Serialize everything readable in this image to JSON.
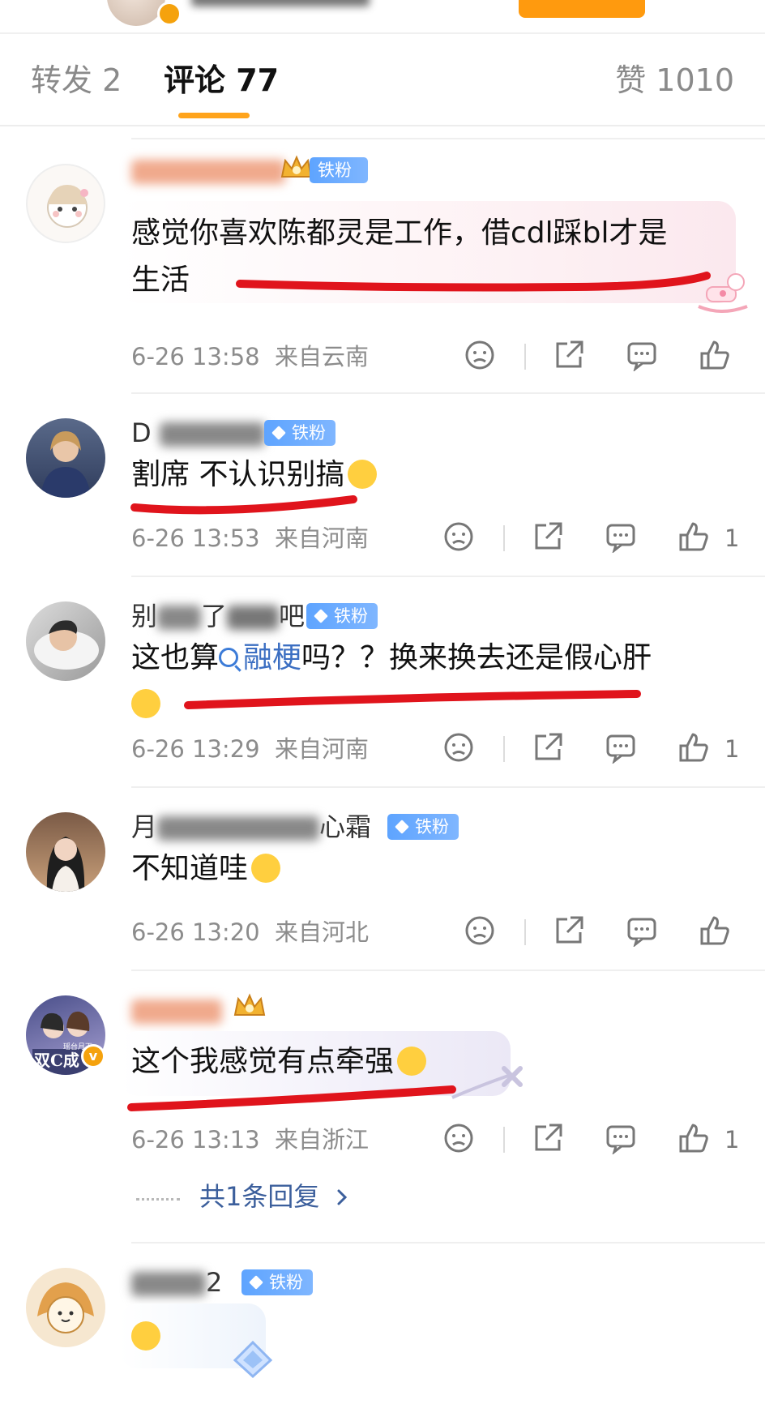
{
  "tabs": {
    "repost": "转发 2",
    "comment": "评论 77",
    "like": "赞 1010"
  },
  "comments": [
    {
      "badge": "铁粉4",
      "text_line1": "感觉你喜欢陈都灵是工作，借cdl踩bl才是",
      "text_line2": "生活",
      "time": "6-26 13:58",
      "location": "来自云南",
      "likes": ""
    },
    {
      "name_visible": "D",
      "badge": "铁粉4",
      "text": "割席 不认识别搞",
      "time": "6-26 13:53",
      "location": "来自河南",
      "likes": "1"
    },
    {
      "name_visible": "别",
      "name_mid": "了",
      "name_end": "吧",
      "badge": "铁粉2",
      "text_pre": "这也算",
      "topic": "融梗",
      "text_post": "吗？？换来换去还是假心肝",
      "time": "6-26 13:29",
      "location": "来自河南",
      "likes": "1"
    },
    {
      "name_visible": "月",
      "name_end": "心霜",
      "badge": "铁粉2",
      "text": "不知道哇",
      "time": "6-26 13:20",
      "location": "来自河北",
      "likes": ""
    },
    {
      "avatar_text": "双C成",
      "avatar_caption": "瑶台月下",
      "text": "这个我感觉有点牵强",
      "time": "6-26 13:13",
      "location": "来自浙江",
      "likes": "1",
      "replies": "共1条回复"
    },
    {
      "name_end": "2",
      "badge": "铁粉5"
    }
  ],
  "icon_names": [
    "dislike-icon",
    "share-icon",
    "reply-icon",
    "like-icon",
    "search-icon",
    "crown-icon",
    "diamond-icon"
  ],
  "colors": {
    "accent": "#ffa41c",
    "badge_blue": "#6aa9ff",
    "annotation_red": "#e0141c",
    "link_blue": "#3c5f9c",
    "meta_gray": "#8c8c8c"
  }
}
